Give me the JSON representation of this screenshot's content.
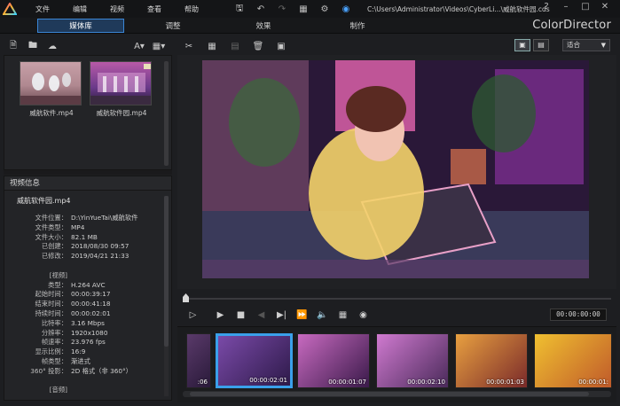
{
  "menu": [
    "文件",
    "编辑",
    "视频",
    "查看",
    "帮助"
  ],
  "title_path": "C:\\Users\\Administrator\\Videos\\CyberLi...\\威航软件园.cds",
  "brand": "ColorDirector",
  "modes": [
    "媒体库",
    "调整",
    "效果",
    "制作"
  ],
  "active_mode": "媒体库",
  "library": {
    "items": [
      {
        "name": "威航软件.mp4"
      },
      {
        "name": "威航软件园.mp4"
      }
    ],
    "font_label": "A"
  },
  "info": {
    "title": "视频信息",
    "file": "威航软件园.mp4",
    "rows": [
      {
        "k": "文件位置：",
        "v": "D:\\YinYueTai\\威航软件"
      },
      {
        "k": "文件类型：",
        "v": "MP4"
      },
      {
        "k": "文件大小：",
        "v": "82.1 MB"
      },
      {
        "k": "已创建：",
        "v": "2018/08/30 09:57"
      },
      {
        "k": "已修改：",
        "v": "2019/04/21 21:33"
      },
      {
        "k": "",
        "v": ""
      },
      {
        "k": "[视频]",
        "v": ""
      },
      {
        "k": "类型：",
        "v": "H.264 AVC"
      },
      {
        "k": "起始时间：",
        "v": "00:00:39:17"
      },
      {
        "k": "结束时间：",
        "v": "00:00:41:18"
      },
      {
        "k": "持续时间：",
        "v": "00:00:02:01"
      },
      {
        "k": "比特率：",
        "v": "3.16 Mbps"
      },
      {
        "k": "分辨率：",
        "v": "1920x1080"
      },
      {
        "k": "帧速率：",
        "v": "23.976 fps"
      },
      {
        "k": "显示比例：",
        "v": "16:9"
      },
      {
        "k": "帧类型：",
        "v": "渐进式"
      },
      {
        "k": "360° 投影：",
        "v": "2D 格式（非 360°）"
      },
      {
        "k": "",
        "v": ""
      },
      {
        "k": "[音频]",
        "v": ""
      }
    ]
  },
  "view": {
    "fit": "适合"
  },
  "timecode": "00:00:00:00",
  "frames": [
    {
      "tc": ":06"
    },
    {
      "tc": "00:00:02:01"
    },
    {
      "tc": "00:00:01:07"
    },
    {
      "tc": "00:00:02:10"
    },
    {
      "tc": "00:00:01:03"
    },
    {
      "tc": "00:00:01:"
    }
  ],
  "colors": {
    "accent": "#3aa0ea",
    "active_tab_bg": "#1f3a5a"
  }
}
